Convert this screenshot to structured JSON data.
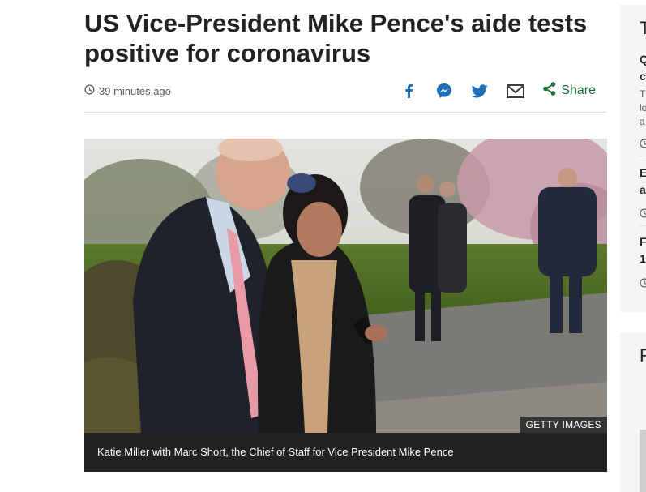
{
  "article": {
    "headline": "US Vice-President Mike Pence's aide tests positive for coronavirus",
    "timestamp": "39 minutes ago"
  },
  "share": {
    "icons": [
      "facebook-icon",
      "messenger-icon",
      "twitter-icon",
      "email-icon",
      "share-icon"
    ],
    "label": "Share",
    "accent_color": "#1a6f37",
    "brand_blue": "#1d6fb8"
  },
  "figure": {
    "credit": "GETTY IMAGES",
    "caption": "Katie Miller with Marc Short, the Chief of Staff for Vice President Mike Pence"
  },
  "sidebar": {
    "top_card": {
      "title": "T",
      "items": [
        {
          "headline_lines": [
            "Q",
            "c"
          ],
          "summary_lines": [
            "T",
            "lo",
            "a"
          ]
        },
        {
          "headline_lines": [
            "E",
            "a"
          ]
        },
        {
          "headline_lines": [
            "F",
            "1"
          ]
        }
      ]
    },
    "bottom_card": {
      "title": "F"
    }
  }
}
